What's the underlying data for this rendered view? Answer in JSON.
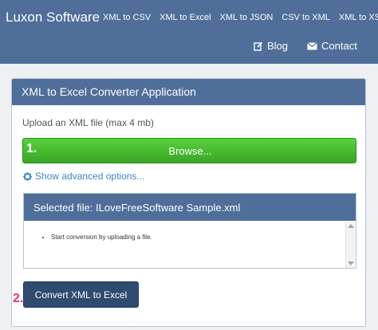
{
  "navbar": {
    "brand": "Luxon Software",
    "links": [
      "XML to CSV",
      "XML to Excel",
      "XML to JSON",
      "CSV to XML",
      "XML to XSD"
    ],
    "blog": "Blog",
    "blog_icon": "edit-icon",
    "contact": "Contact",
    "contact_icon": "envelope-icon"
  },
  "panel": {
    "title": "XML to Excel Converter Application",
    "upload_label": "Upload an XML file (max 4 mb)",
    "browse_label": "Browse...",
    "step_one": "1.",
    "advanced_label": "Show advanced options...",
    "advanced_icon": "gear-icon",
    "selected_file": "Selected file: ILoveFreeSoftware Sample.xml",
    "log_items": [
      "Start conversion by uploading a file."
    ],
    "step_two": "2.",
    "convert_label": "Convert XML to Excel"
  },
  "colors": {
    "brand_blue": "#4f6e9a",
    "browse_green": "#3aa526",
    "convert_navy": "#2f4b70",
    "step_pink": "#e8316f",
    "link_blue": "#3a87c8"
  }
}
